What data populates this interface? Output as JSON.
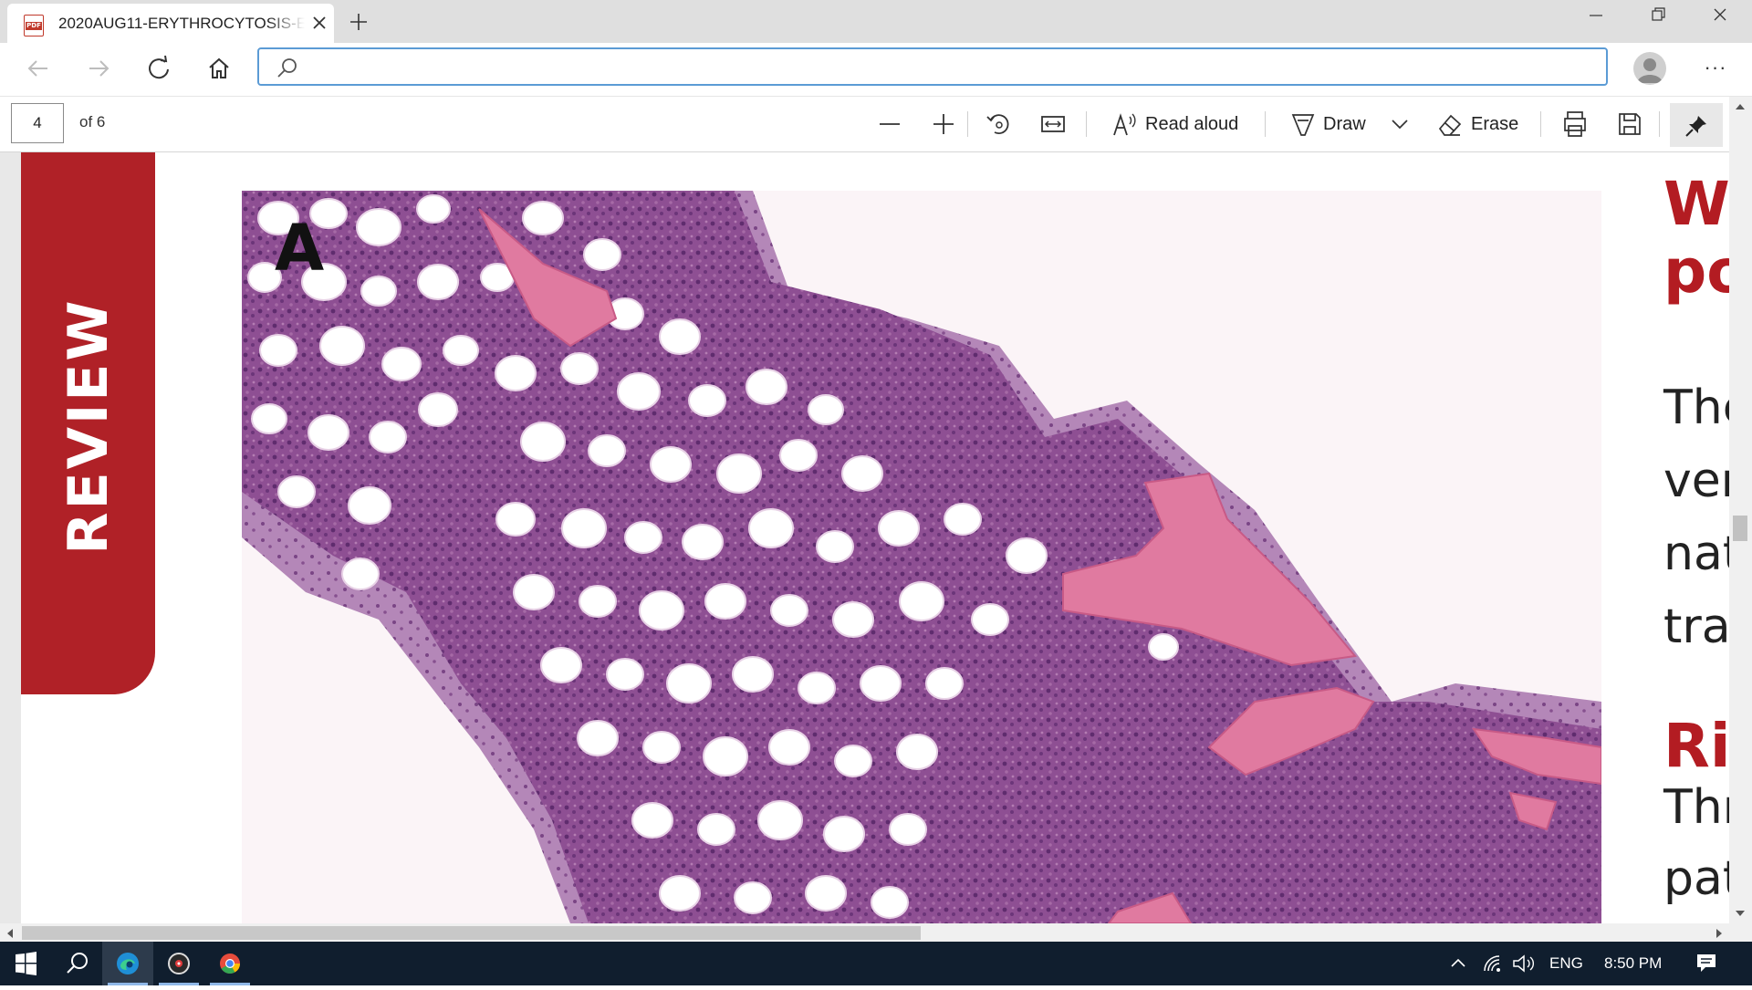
{
  "browser": {
    "tab": {
      "title": "2020AUG11-ERYTHROCYTOSIS-E",
      "icon": "pdf-file-icon"
    },
    "address_bar": {
      "value": "",
      "placeholder": ""
    },
    "window_controls": [
      "minimize",
      "restore",
      "close"
    ]
  },
  "pdf_toolbar": {
    "page_number": "4",
    "page_of": "of 6",
    "read_aloud_label": "Read aloud",
    "draw_label": "Draw",
    "erase_label": "Erase"
  },
  "document": {
    "side_band_label": "REVIEW",
    "side_band_color": "#b02127",
    "figure_label": "A",
    "figure_description_colors": {
      "bone": "#e07aa0",
      "marrow": "#8b4a8f",
      "fat": "#ffffff"
    },
    "right_column": {
      "heading_1_line_1": "Wl",
      "heading_1_line_2": "po",
      "body_1": [
        "The",
        "ver",
        "nat",
        "trai"
      ],
      "heading_2": "Ris",
      "body_2": [
        "Thr",
        "pat"
      ]
    },
    "accent_color": "#b31c22"
  },
  "taskbar": {
    "language": "ENG",
    "time": "8:50 PM"
  }
}
